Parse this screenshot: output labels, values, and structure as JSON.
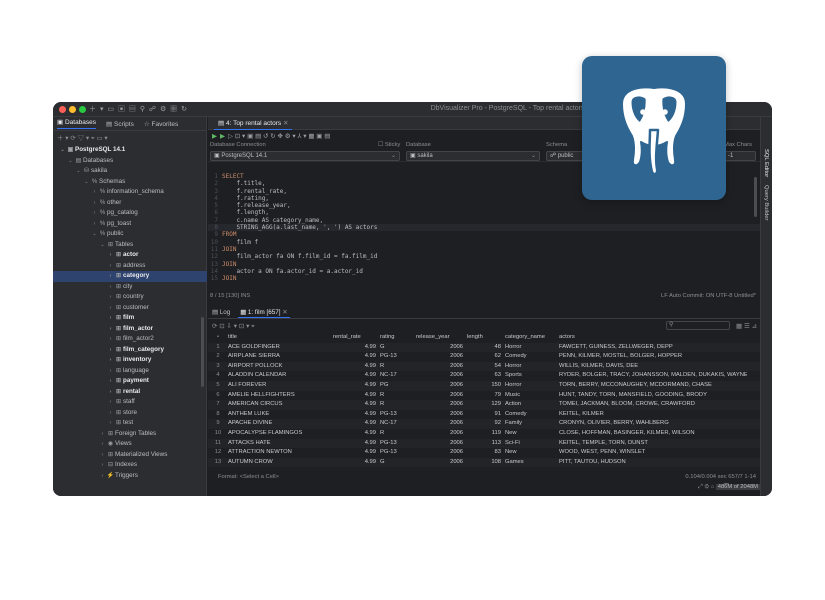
{
  "window": {
    "title": "DbVisualizer Pro - PostgreSQL - Top rental actors.sql"
  },
  "sidebar": {
    "tabs": [
      {
        "label": "Databases"
      },
      {
        "label": "Scripts"
      },
      {
        "label": "Favorites"
      }
    ],
    "tree": [
      {
        "label": "PostgreSQL 14.1",
        "icon": "server-icon",
        "level": 0,
        "open": true,
        "bold": true
      },
      {
        "label": "Databases",
        "icon": "folder-icon",
        "level": 1,
        "open": true
      },
      {
        "label": "sakila",
        "icon": "database-icon",
        "level": 2,
        "open": true
      },
      {
        "label": "Schemas",
        "icon": "schema-icon",
        "level": 3,
        "open": true
      },
      {
        "label": "information_schema",
        "icon": "schema-icon",
        "level": 4,
        "open": false
      },
      {
        "label": "other",
        "icon": "schema-icon",
        "level": 4,
        "open": false
      },
      {
        "label": "pg_catalog",
        "icon": "schema-icon",
        "level": 4,
        "open": false
      },
      {
        "label": "pg_toast",
        "icon": "schema-icon",
        "level": 4,
        "open": false
      },
      {
        "label": "public",
        "icon": "schema-icon",
        "level": 4,
        "open": true
      },
      {
        "label": "Tables",
        "icon": "table-icon",
        "level": 5,
        "open": true
      },
      {
        "label": "actor",
        "icon": "table-icon",
        "level": 6,
        "open": false,
        "bold": true
      },
      {
        "label": "address",
        "icon": "table-icon",
        "level": 6,
        "open": false
      },
      {
        "label": "category",
        "icon": "table-icon",
        "level": 6,
        "open": false,
        "bold": true,
        "selected": true
      },
      {
        "label": "city",
        "icon": "table-icon",
        "level": 6,
        "open": false
      },
      {
        "label": "country",
        "icon": "table-icon",
        "level": 6,
        "open": false
      },
      {
        "label": "customer",
        "icon": "table-icon",
        "level": 6,
        "open": false
      },
      {
        "label": "film",
        "icon": "table-icon",
        "level": 6,
        "open": false,
        "bold": true
      },
      {
        "label": "film_actor",
        "icon": "table-icon",
        "level": 6,
        "open": false,
        "bold": true
      },
      {
        "label": "film_actor2",
        "icon": "table-icon",
        "level": 6,
        "open": false
      },
      {
        "label": "film_category",
        "icon": "table-icon",
        "level": 6,
        "open": false,
        "bold": true
      },
      {
        "label": "inventory",
        "icon": "table-icon",
        "level": 6,
        "open": false,
        "bold": true
      },
      {
        "label": "language",
        "icon": "table-icon",
        "level": 6,
        "open": false
      },
      {
        "label": "payment",
        "icon": "table-icon",
        "level": 6,
        "open": false,
        "bold": true
      },
      {
        "label": "rental",
        "icon": "table-icon",
        "level": 6,
        "open": false,
        "bold": true
      },
      {
        "label": "staff",
        "icon": "table-icon",
        "level": 6,
        "open": false
      },
      {
        "label": "store",
        "icon": "table-icon",
        "level": 6,
        "open": false
      },
      {
        "label": "test",
        "icon": "table-icon",
        "level": 6,
        "open": false
      },
      {
        "label": "Foreign Tables",
        "icon": "table-icon",
        "level": 5,
        "open": false
      },
      {
        "label": "Views",
        "icon": "eye-icon",
        "level": 5,
        "open": false
      },
      {
        "label": "Materialized Views",
        "icon": "table-icon",
        "level": 5,
        "open": false
      },
      {
        "label": "Indexes",
        "icon": "index-icon",
        "level": 5,
        "open": false
      },
      {
        "label": "Triggers",
        "icon": "trigger-icon",
        "level": 5,
        "open": false
      }
    ]
  },
  "editor": {
    "tab": "4: Top rental actors",
    "conn_labels": {
      "database_connection": "Database Connection",
      "sticky": "Sticky",
      "database": "Database",
      "schema": "Schema",
      "max_chars": "Max Chars"
    },
    "conn_values": {
      "connection": "PostgreSQL 14.1",
      "database": "sakila",
      "schema": "public",
      "max_chars": "-1"
    },
    "code": [
      {
        "n": "1",
        "t": "SELECT",
        "k": "kw"
      },
      {
        "n": "2",
        "t": "    f.title,",
        "k": ""
      },
      {
        "n": "3",
        "t": "    f.rental_rate,",
        "k": ""
      },
      {
        "n": "4",
        "t": "    f.rating,",
        "k": ""
      },
      {
        "n": "5",
        "t": "    f.release_year,",
        "k": ""
      },
      {
        "n": "6",
        "t": "    f.length,",
        "k": ""
      },
      {
        "n": "7",
        "t": "    c.name AS category_name,",
        "k": ""
      },
      {
        "n": "8",
        "t": "    STRING_AGG(a.last_name, ', ') AS actors",
        "k": "cur"
      },
      {
        "n": "9",
        "t": "FROM",
        "k": "kw"
      },
      {
        "n": "10",
        "t": "    film f",
        "k": ""
      },
      {
        "n": "11",
        "t": "JOIN",
        "k": "kw"
      },
      {
        "n": "12",
        "t": "    film_actor fa ON f.film_id = fa.film_id",
        "k": ""
      },
      {
        "n": "13",
        "t": "JOIN",
        "k": "kw"
      },
      {
        "n": "14",
        "t": "    actor a ON fa.actor_id = a.actor_id",
        "k": ""
      },
      {
        "n": "15",
        "t": "JOIN",
        "k": "kw"
      }
    ],
    "status_left": "8 / 15 [130]  INS",
    "status_right": "LF   Auto Commit: ON   UTF-8   Untitled*"
  },
  "results": {
    "tabs": [
      {
        "label": "Log"
      },
      {
        "label": "1: film [657]"
      }
    ],
    "columns": [
      "title",
      "rental_rate",
      "rating",
      "release_year",
      "length",
      "category_name",
      "actors"
    ],
    "rows": [
      [
        "1",
        "ACE GOLDFINGER",
        "4.99",
        "G",
        "2006",
        "48",
        "Horror",
        "FAWCETT, GUINESS, ZELLWEGER, DEPP"
      ],
      [
        "2",
        "AIRPLANE SIERRA",
        "4.99",
        "PG-13",
        "2006",
        "62",
        "Comedy",
        "PENN, KILMER, MOSTEL, BOLGER, HOPPER"
      ],
      [
        "3",
        "AIRPORT POLLOCK",
        "4.99",
        "R",
        "2006",
        "54",
        "Horror",
        "WILLIS, KILMER, DAVIS, DEE"
      ],
      [
        "4",
        "ALADDIN CALENDAR",
        "4.99",
        "NC-17",
        "2006",
        "63",
        "Sports",
        "RYDER, BOLGER, TRACY, JOHANSSON, MALDEN, DUKAKIS, WAYNE,"
      ],
      [
        "5",
        "ALI FOREVER",
        "4.99",
        "PG",
        "2006",
        "150",
        "Horror",
        "TORN, BERRY, MCCONAUGHEY, MCDORMAND, CHASE"
      ],
      [
        "6",
        "AMELIE HELLFIGHTERS",
        "4.99",
        "R",
        "2006",
        "79",
        "Music",
        "HUNT, TANDY, TORN, MANSFIELD, GOODING, BRODY"
      ],
      [
        "7",
        "AMERICAN CIRCUS",
        "4.99",
        "R",
        "2006",
        "129",
        "Action",
        "TOMEI, JACKMAN, BLOOM, CROWE, CRAWFORD"
      ],
      [
        "8",
        "ANTHEM LUKE",
        "4.99",
        "PG-13",
        "2006",
        "91",
        "Comedy",
        "KEITEL, KILMER"
      ],
      [
        "9",
        "APACHE DIVINE",
        "4.99",
        "NC-17",
        "2006",
        "92",
        "Family",
        "CRONYN, OLIVIER, BERRY, WAHLBERG"
      ],
      [
        "10",
        "APOCALYPSE FLAMINGOS",
        "4.99",
        "R",
        "2006",
        "119",
        "New",
        "CLOSE, HOFFMAN, BASINGER, KILMER, WILSON"
      ],
      [
        "11",
        "ATTACKS HATE",
        "4.99",
        "PG-13",
        "2006",
        "113",
        "Sci-Fi",
        "KEITEL, TEMPLE, TORN, DUNST"
      ],
      [
        "12",
        "ATTRACTION NEWTON",
        "4.99",
        "PG-13",
        "2006",
        "83",
        "New",
        "WOOD, WEST, PENN, WINSLET"
      ],
      [
        "13",
        "AUTUMN CROW",
        "4.99",
        "G",
        "2006",
        "108",
        "Games",
        "PITT, TAUTOU, HUDSON"
      ]
    ],
    "format_label": "Format: <Select a Cell>",
    "timing": "0.104/0.004 sec   657/7   1-14",
    "memory": "486M of 2048M"
  },
  "right_strip": {
    "sql_editor": "SQL Editor",
    "query_builder": "Query Builder"
  },
  "logo": {
    "icon": "postgresql-elephant-icon",
    "bg": "#2f6591"
  }
}
